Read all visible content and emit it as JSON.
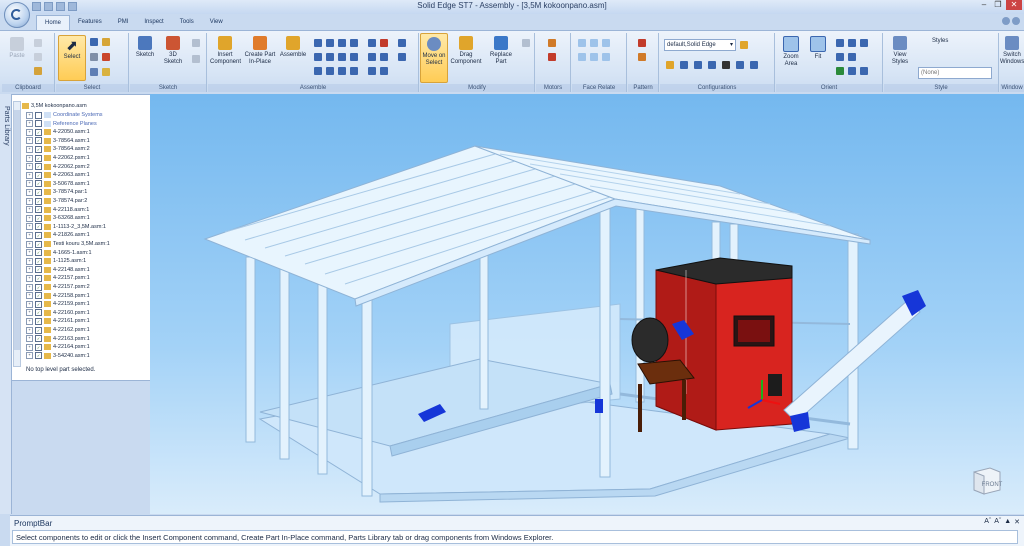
{
  "window": {
    "title": "Solid Edge ST7 - Assembly - [3,5M kokoonpano.asm]"
  },
  "tabs": [
    "Home",
    "Features",
    "PMI",
    "Inspect",
    "Tools",
    "View"
  ],
  "ribbon": {
    "clipboard": {
      "label": "Clipboard",
      "paste": "Paste"
    },
    "select": {
      "label": "Select",
      "select_btn": "Select"
    },
    "sketch": {
      "label": "Sketch",
      "sketch_btn": "Sketch",
      "sketch3d": "3D Sketch"
    },
    "assemble": {
      "label": "Assemble",
      "insert": "Insert Component",
      "create_part": "Create Part In-Place",
      "assemble_btn": "Assemble"
    },
    "modify": {
      "label": "Modify",
      "move_on_select": "Move on Select",
      "drag": "Drag Component",
      "replace": "Replace Part"
    },
    "motors": {
      "label": "Motors"
    },
    "face_relate": {
      "label": "Face Relate"
    },
    "pattern": {
      "label": "Pattern"
    },
    "configurations": {
      "label": "Configurations",
      "current": "default,Solid Edge"
    },
    "orient": {
      "label": "Orient",
      "zoom_area": "Zoom Area",
      "fit": "Fit"
    },
    "style": {
      "label": "Style",
      "view_styles": "View Styles",
      "styles_label": "Styles",
      "styles_value": "(None)",
      "switch_windows": "Switch Windows"
    },
    "window_group": {
      "label": "Window"
    }
  },
  "side_tab": {
    "parts_library": "Parts Library"
  },
  "pathfinder": {
    "root": "3,5M kokoonpano.asm",
    "items": [
      {
        "label": "Coordinate Systems",
        "ref": true
      },
      {
        "label": "Reference Planes",
        "ref": true
      },
      {
        "label": "4-22050.asm:1"
      },
      {
        "label": "3-78564.asm:1"
      },
      {
        "label": "3-78564.asm:2"
      },
      {
        "label": "4-22062.psm:1"
      },
      {
        "label": "4-22062.psm:2"
      },
      {
        "label": "4-22063.asm:1"
      },
      {
        "label": "3-50678.asm:1"
      },
      {
        "label": "3-78574.par:1"
      },
      {
        "label": "3-78574.par:2"
      },
      {
        "label": "4-22118.asm:1"
      },
      {
        "label": "3-63268.asm:1"
      },
      {
        "label": "1-1113-2_3,5M.asm:1"
      },
      {
        "label": "4-21826.asm:1"
      },
      {
        "label": "Testi kouru 3,5M.asm:1"
      },
      {
        "label": "4-1665-1.asm:1"
      },
      {
        "label": "1-1125.asm:1"
      },
      {
        "label": "4-22148.asm:1"
      },
      {
        "label": "4-22157.psm:1"
      },
      {
        "label": "4-22157.psm:2"
      },
      {
        "label": "4-22158.psm:1"
      },
      {
        "label": "4-22159.psm:1"
      },
      {
        "label": "4-22160.psm:1"
      },
      {
        "label": "4-22161.psm:1"
      },
      {
        "label": "4-22162.psm:1"
      },
      {
        "label": "4-22163.psm:1"
      },
      {
        "label": "4-22164.psm:1"
      },
      {
        "label": "3-54240.asm:1"
      }
    ],
    "status": "No top level part selected."
  },
  "viewport": {
    "view_cube_label": "FRONT"
  },
  "promptbar": {
    "title": "PromptBar",
    "text": "Select components to edit or click the Insert Component command, Create Part In-Place command, Parts Library tab or drag components from Windows Explorer."
  },
  "colors": {
    "boiler_red": "#e01a1a",
    "structure": "#dff0fd",
    "viewport_top": "#74b8ef",
    "accent_blue": "#1636d8"
  }
}
